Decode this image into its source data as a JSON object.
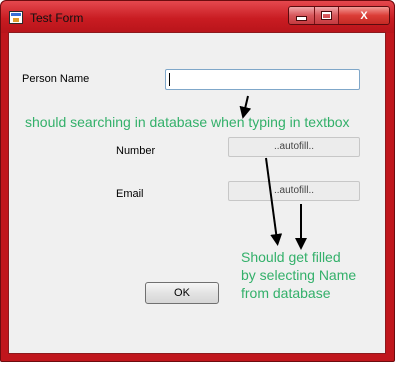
{
  "window": {
    "title": "Test Form",
    "controls": {
      "minimize_icon": "minimize-icon",
      "maximize_icon": "maximize-icon",
      "close_label": "X"
    }
  },
  "form": {
    "person_name_label": "Person Name",
    "person_name_value": "",
    "number_label": "Number",
    "number_value": "..autofill..",
    "email_label": "Email",
    "email_value": "..autofill..",
    "ok_label": "OK"
  },
  "annotations": {
    "search_note": "should searching in database when typing in textbox",
    "fill_note_line1": "Should get filled",
    "fill_note_line2": "by selecting Name",
    "fill_note_line3": "from database",
    "color": "#33b06a"
  }
}
